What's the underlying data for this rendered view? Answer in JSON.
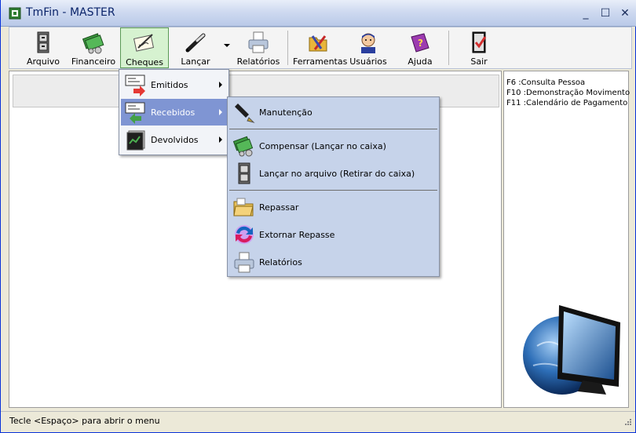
{
  "window": {
    "title": "TmFin - MASTER",
    "controls": {
      "minimize": "_",
      "maximize": "☐",
      "close": "✕"
    }
  },
  "toolbar": {
    "items": [
      {
        "label": "Arquivo",
        "icon": "cabinet-icon"
      },
      {
        "label": "Financeiro",
        "icon": "money-icon"
      },
      {
        "label": "Cheques",
        "icon": "cheque-pen-icon",
        "active": true
      },
      {
        "label": "Lançar",
        "icon": "pen-icon",
        "has_dropdown": true
      },
      {
        "label": "Relatórios",
        "icon": "printer-icon"
      },
      {
        "label": "Ferramentas",
        "icon": "tools-icon"
      },
      {
        "label": "Usuários",
        "icon": "user-icon"
      },
      {
        "label": "Ajuda",
        "icon": "help-book-icon"
      },
      {
        "label": "Sair",
        "icon": "exit-door-icon"
      }
    ]
  },
  "menu_cheques": {
    "items": [
      {
        "label": "Emitidos",
        "icon": "cheque-out-icon",
        "has_submenu": true
      },
      {
        "label": "Recebidos",
        "icon": "cheque-in-icon",
        "has_submenu": true,
        "selected": true
      },
      {
        "label": "Devolvidos",
        "icon": "cheque-return-icon",
        "has_submenu": true
      }
    ]
  },
  "menu_recebidos": {
    "items": [
      {
        "label": "Manutenção",
        "icon": "fountain-pen-icon"
      },
      {
        "label": "Compensar (Lançar no caixa)",
        "icon": "money-icon"
      },
      {
        "label": "Lançar no arquivo (Retirar do caixa)",
        "icon": "cabinet-icon"
      },
      {
        "label": "Repassar",
        "icon": "folders-icon"
      },
      {
        "label": "Extornar Repasse",
        "icon": "refresh-icon"
      },
      {
        "label": "Relatórios",
        "icon": "printer-icon"
      }
    ]
  },
  "side_panel": {
    "hotkeys": [
      "F6 :Consulta Pessoa",
      "F10 :Demonstração Movimento",
      "F11 :Calendário de Pagamento"
    ]
  },
  "status": {
    "text": "Tecle <Espaço> para abrir o menu"
  },
  "colors": {
    "menu_highlight": "#7f95d3",
    "title_text": "#0a246a",
    "active_button": "#d6f2d0"
  }
}
